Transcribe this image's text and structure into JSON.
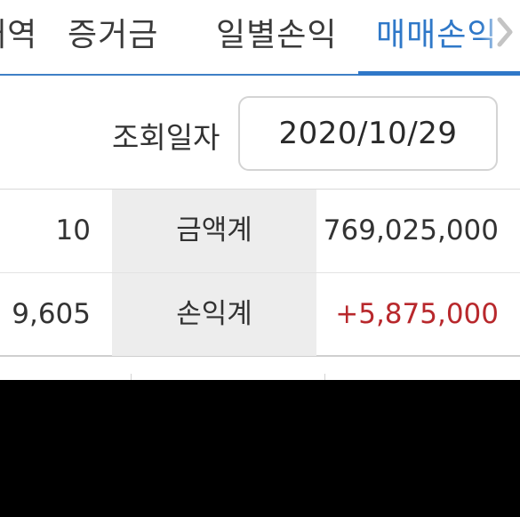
{
  "tabs": [
    {
      "label": "내역",
      "state": "partially-visible"
    },
    {
      "label": "증거금",
      "state": "normal"
    },
    {
      "label": "일별손익",
      "state": "normal"
    },
    {
      "label": "매매손익",
      "state": "selected"
    }
  ],
  "colors": {
    "accent": "#2f78c8",
    "positive": "#b8282c",
    "label_cell_bg": "#ededed",
    "redacted": "#000000"
  },
  "query": {
    "label": "조회일자",
    "date_value": "2020/10/29"
  },
  "summary_rows": [
    {
      "left_value": "10",
      "label": "금액계",
      "value": "769,025,000"
    },
    {
      "left_value": "9,605",
      "label": "손익계",
      "value": "+5,875,000"
    }
  ],
  "icons": {
    "tab_scroll": "chevron-right-icon"
  }
}
